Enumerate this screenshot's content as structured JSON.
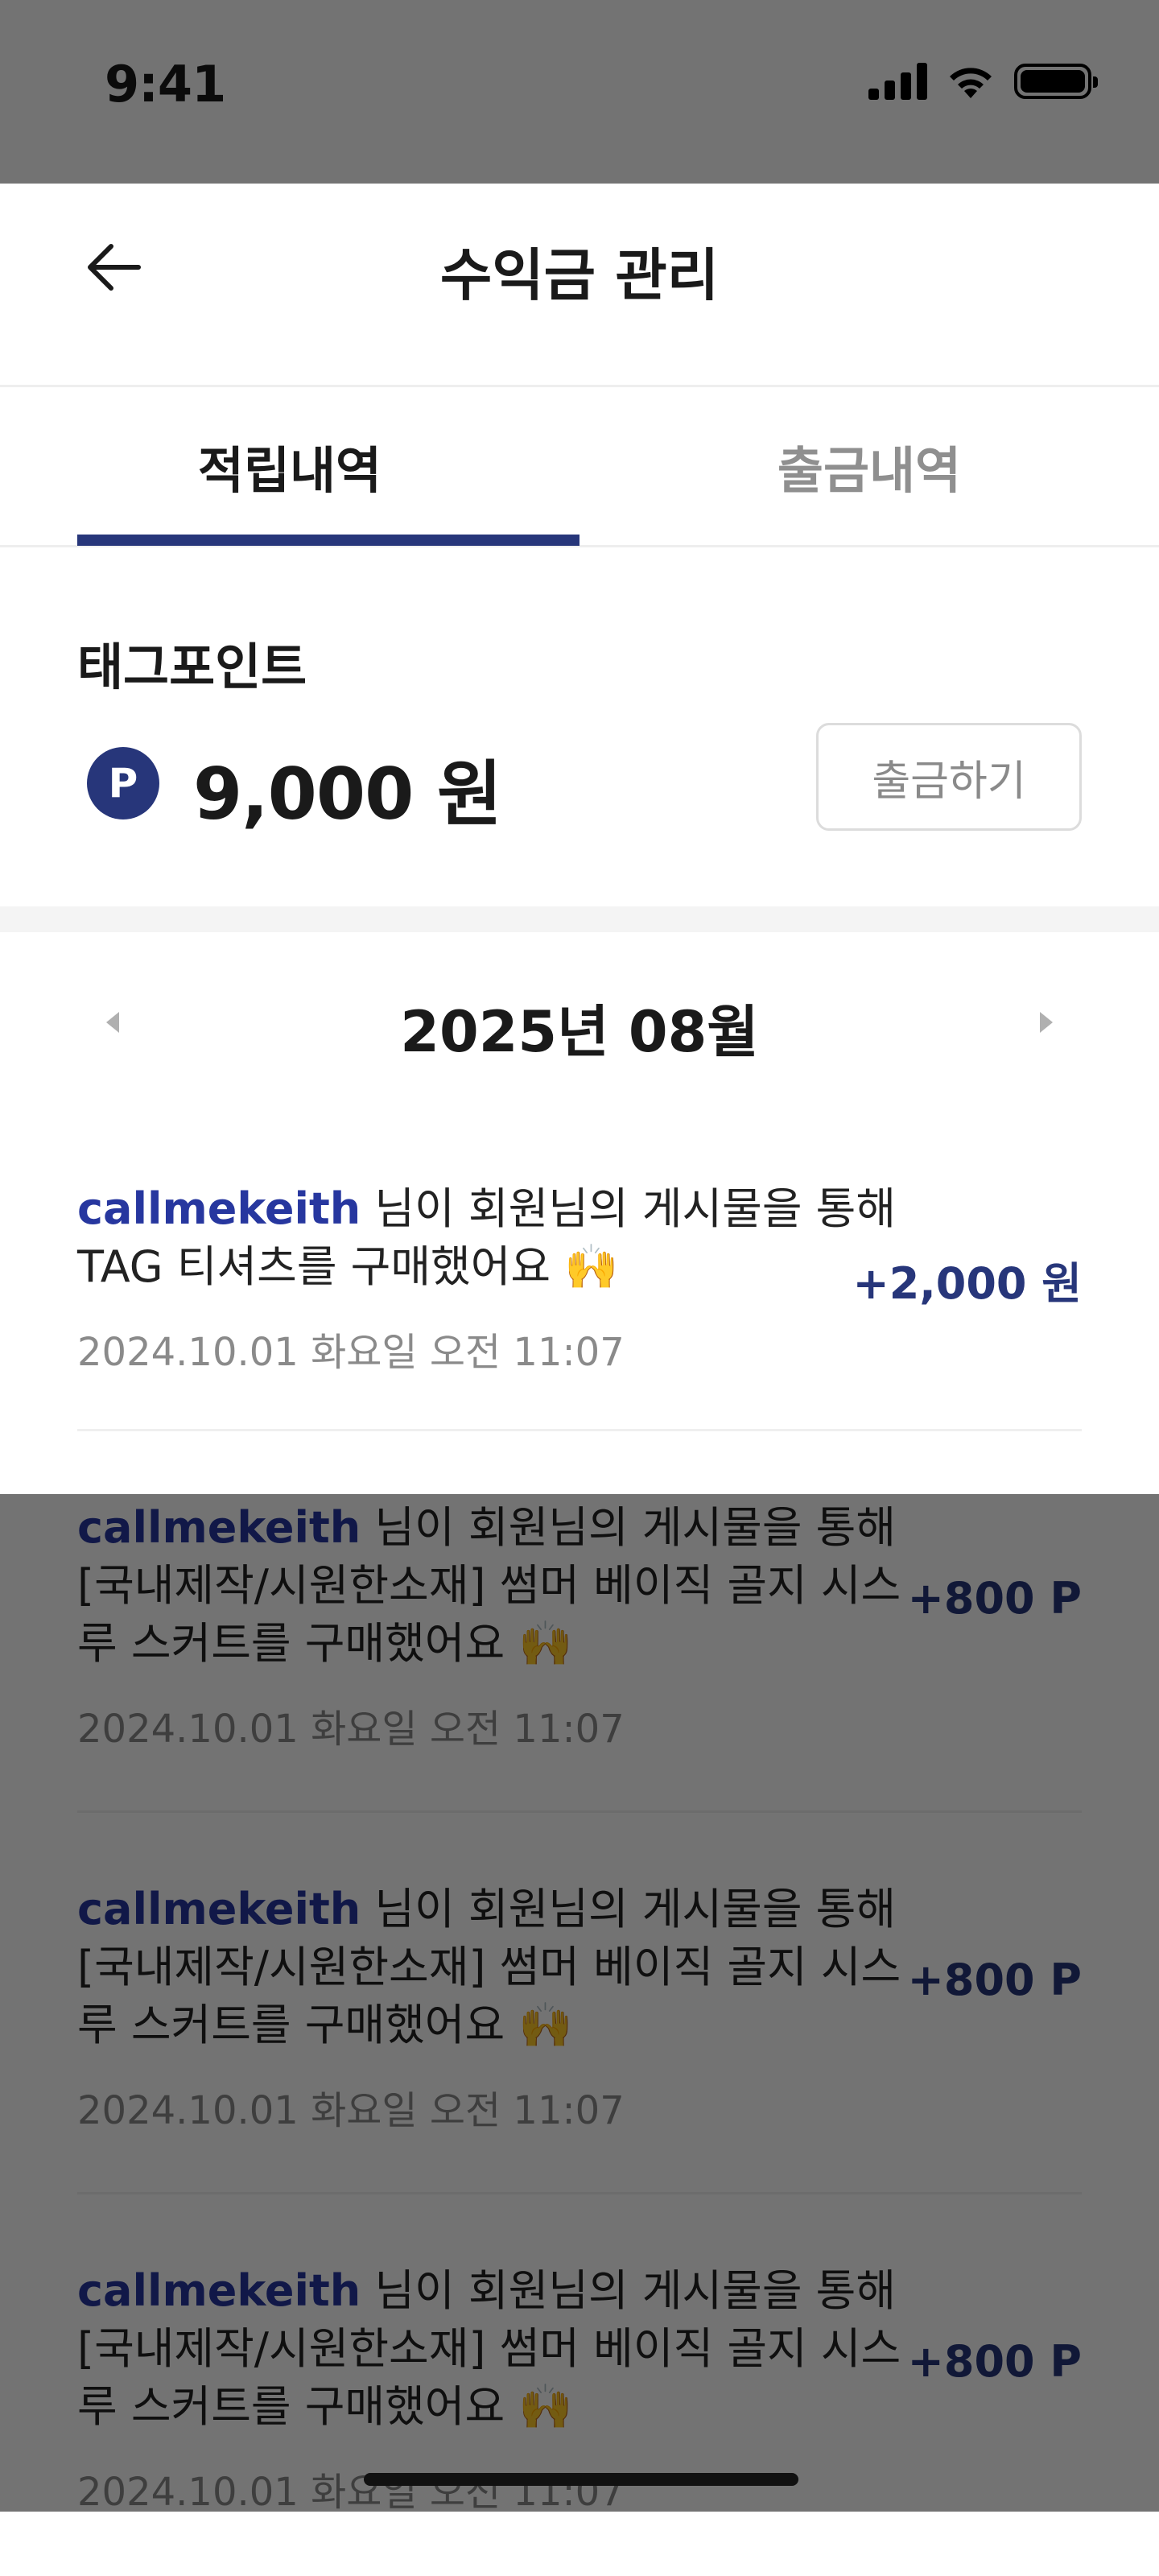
{
  "status_bar": {
    "time": "9:41"
  },
  "header": {
    "title": "수익금 관리"
  },
  "tabs": [
    {
      "label": "적립내역",
      "active": true
    },
    {
      "label": "출금내역",
      "active": false
    }
  ],
  "balance": {
    "label": "태그포인트",
    "icon_letter": "P",
    "amount": "9,000 원",
    "withdraw_label": "출금하기"
  },
  "month_nav": {
    "label": "2025년 08월"
  },
  "items": [
    {
      "user": "callmekeith",
      "message": " 님이 회원님의 게시물을 통해 TAG 티셔츠를 구매했어요 🙌",
      "date": "2024.10.01 화요일 오전 11:07",
      "amount": "+2,000 원"
    },
    {
      "user": "callmekeith",
      "message": " 님이 회원님의 게시물을 통해 [국내제작/시원한소재] 썸머 베이직 골지 시스루 스커트를 구매했어요 🙌",
      "date": "2024.10.01 화요일 오전 11:07",
      "amount": "+800 P"
    },
    {
      "user": "callmekeith",
      "message": " 님이 회원님의 게시물을 통해 [국내제작/시원한소재] 썸머 베이직 골지 시스루 스커트를 구매했어요 🙌",
      "date": "2024.10.01 화요일 오전 11:07",
      "amount": "+800 P"
    },
    {
      "user": "callmekeith",
      "message": " 님이 회원님의 게시물을 통해 [국내제작/시원한소재] 썸머 베이직 골지 시스루 스커트를 구매했어요 🙌",
      "date": "2024.10.01 화요일 오전 11:07",
      "amount": "+800 P"
    }
  ],
  "colors": {
    "accent": "#27367a",
    "username": "#27379f",
    "muted": "#8a8a8a",
    "dim_overlay": "#000000"
  }
}
